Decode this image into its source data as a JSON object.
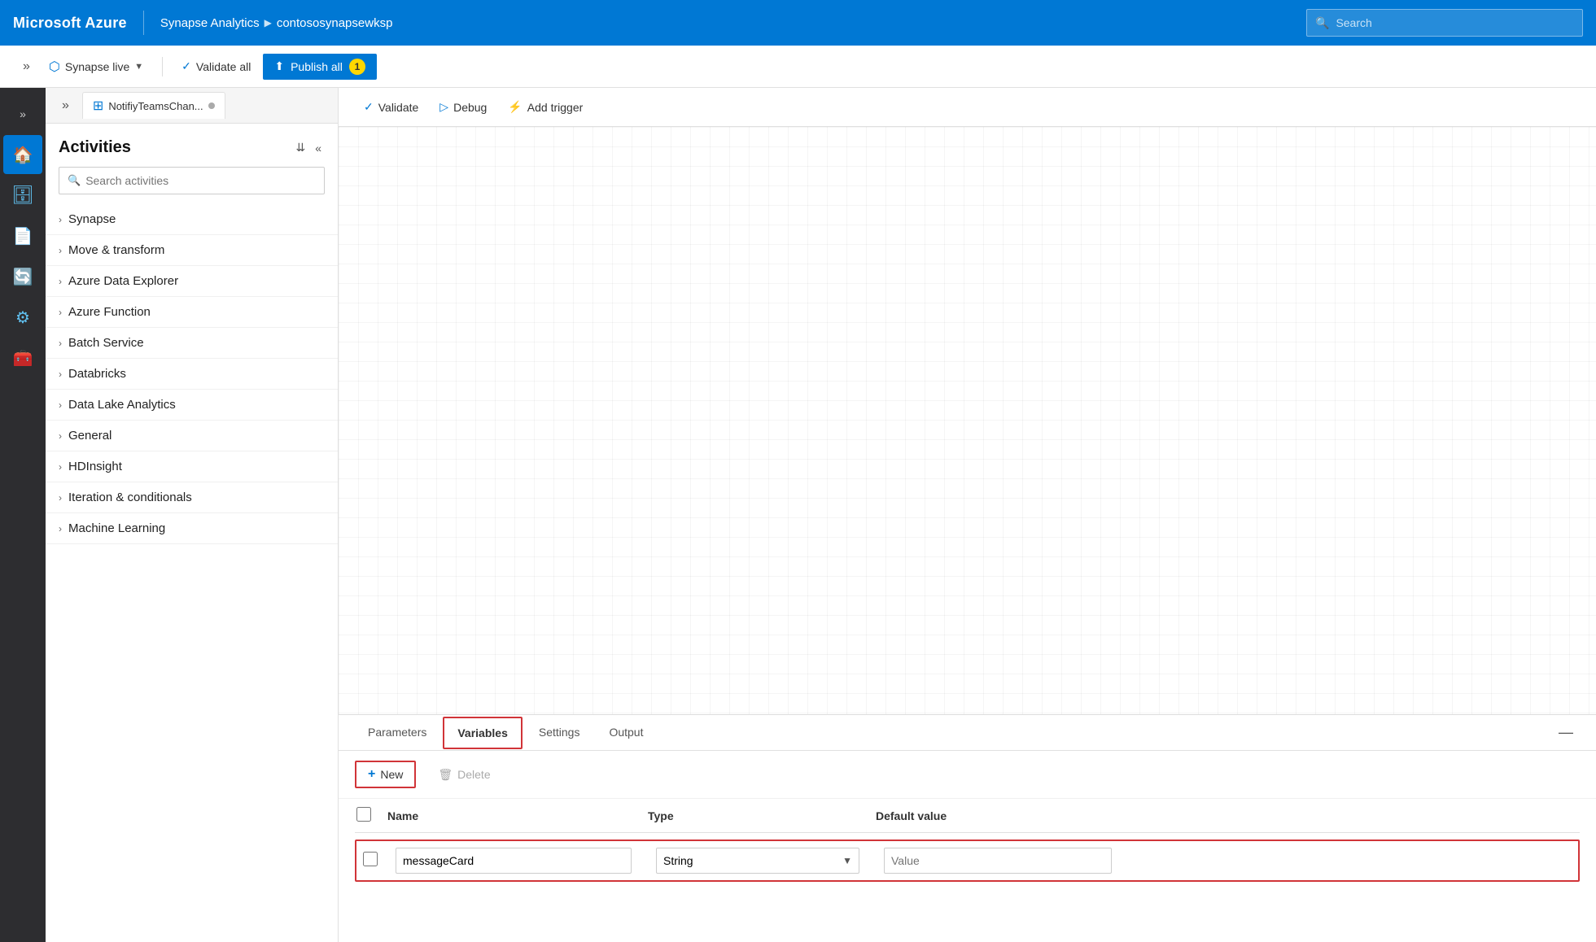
{
  "topbar": {
    "logo": "Microsoft Azure",
    "nav_app": "Synapse Analytics",
    "nav_chevron": "▶",
    "nav_workspace": "contososynapsewksp",
    "search_placeholder": "Search"
  },
  "secondbar": {
    "synapse_live_label": "Synapse live",
    "validate_all_label": "Validate all",
    "publish_all_label": "Publish all",
    "publish_badge": "1"
  },
  "activities_tab": {
    "tab_label": "NotifiyTeamsChan...",
    "tab_dot": true
  },
  "activities": {
    "title": "Activities",
    "search_placeholder": "Search activities",
    "items": [
      {
        "label": "Synapse"
      },
      {
        "label": "Move & transform"
      },
      {
        "label": "Azure Data Explorer"
      },
      {
        "label": "Azure Function"
      },
      {
        "label": "Batch Service"
      },
      {
        "label": "Databricks"
      },
      {
        "label": "Data Lake Analytics"
      },
      {
        "label": "General"
      },
      {
        "label": "HDInsight"
      },
      {
        "label": "Iteration & conditionals"
      },
      {
        "label": "Machine Learning"
      }
    ]
  },
  "canvas_toolbar": {
    "validate_label": "Validate",
    "debug_label": "Debug",
    "add_trigger_label": "Add trigger"
  },
  "bottom_panel": {
    "tabs": [
      {
        "label": "Parameters",
        "active": false
      },
      {
        "label": "Variables",
        "active": true,
        "highlight": true
      },
      {
        "label": "Settings",
        "active": false
      },
      {
        "label": "Output",
        "active": false
      }
    ],
    "new_label": "New",
    "delete_label": "Delete",
    "table_columns": {
      "name": "Name",
      "type": "Type",
      "default_value": "Default value"
    },
    "table_row": {
      "name_value": "messageCard",
      "type_value": "String",
      "default_placeholder": "Value"
    }
  }
}
